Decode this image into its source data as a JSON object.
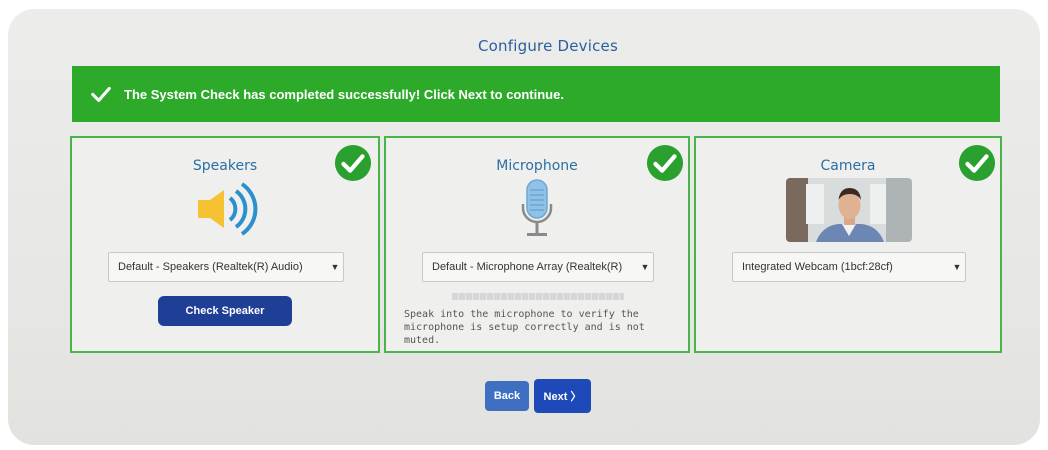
{
  "page": {
    "title": "Configure Devices"
  },
  "banner": {
    "message": "The System Check has completed successfully! Click Next to continue.",
    "color": "#2eaa2a"
  },
  "speakers": {
    "title": "Speakers",
    "icon": "speaker-icon",
    "selected_device": "Default - Speakers (Realtek(R) Audio)",
    "check_button_label": "Check Speaker",
    "status": "check-icon"
  },
  "microphone": {
    "title": "Microphone",
    "icon": "microphone-icon",
    "selected_device": "Default - Microphone Array (Realtek(R)",
    "instructions": "Speak into the microphone to verify the microphone is setup correctly and is not muted.",
    "status": "check-icon"
  },
  "camera": {
    "title": "Camera",
    "icon": "webcam-preview",
    "selected_device": "Integrated Webcam (1bcf:28cf)",
    "status": "check-icon"
  },
  "navigation": {
    "back_label": "Back",
    "next_label": "Next 〉"
  },
  "colors": {
    "accent_green": "#2eaa2a",
    "primary_blue": "#1f3f97",
    "back_blue": "#3f6fc0",
    "title_blue": "#2b5f9c"
  }
}
